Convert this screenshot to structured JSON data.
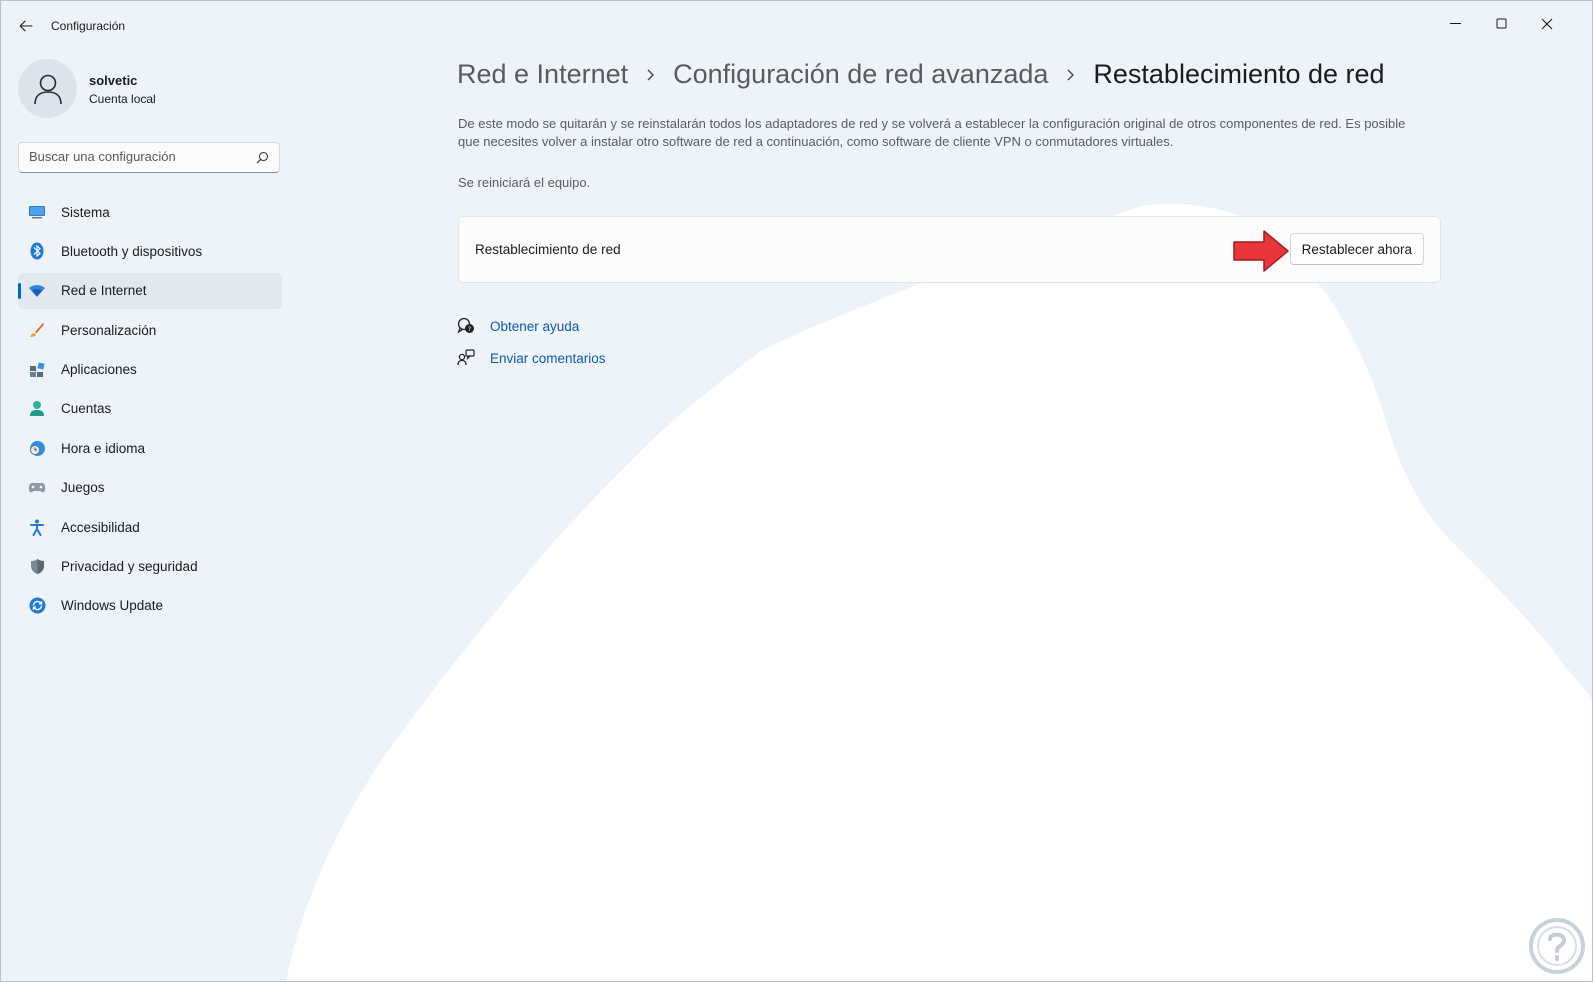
{
  "window": {
    "app_title": "Configuración",
    "controls": [
      "minimize",
      "maximize",
      "close"
    ]
  },
  "user": {
    "name": "solvetic",
    "account_type": "Cuenta local"
  },
  "search": {
    "placeholder": "Buscar una configuración"
  },
  "sidebar": {
    "items": [
      {
        "label": "Sistema",
        "icon": "monitor-icon"
      },
      {
        "label": "Bluetooth y dispositivos",
        "icon": "bluetooth-icon"
      },
      {
        "label": "Red e Internet",
        "icon": "wifi-icon",
        "active": true
      },
      {
        "label": "Personalización",
        "icon": "brush-icon"
      },
      {
        "label": "Aplicaciones",
        "icon": "apps-icon"
      },
      {
        "label": "Cuentas",
        "icon": "person-icon"
      },
      {
        "label": "Hora e idioma",
        "icon": "globe-clock-icon"
      },
      {
        "label": "Juegos",
        "icon": "gamepad-icon"
      },
      {
        "label": "Accesibilidad",
        "icon": "accessibility-icon"
      },
      {
        "label": "Privacidad y seguridad",
        "icon": "shield-icon"
      },
      {
        "label": "Windows Update",
        "icon": "update-icon"
      }
    ]
  },
  "breadcrumb": {
    "items": [
      "Red e Internet",
      "Configuración de red avanzada"
    ],
    "current": "Restablecimiento de red"
  },
  "main": {
    "description": "De este modo se quitarán y se reinstalarán todos los adaptadores de red y se volverá a establecer la configuración original de otros componentes de red. Es posible que necesites volver a instalar otro software de red a continuación, como software de cliente VPN o conmutadores virtuales.",
    "restart_note": "Se reiniciará el equipo.",
    "card": {
      "label": "Restablecimiento de red",
      "button": "Restablecer ahora"
    },
    "links": [
      {
        "label": "Obtener ayuda",
        "icon": "help-chat-icon"
      },
      {
        "label": "Enviar comentarios",
        "icon": "feedback-icon"
      }
    ]
  },
  "colors": {
    "accent": "#0067c0",
    "link": "#0a5aa8",
    "annotation_arrow": "#e8363b",
    "background": "#eef3f9"
  }
}
